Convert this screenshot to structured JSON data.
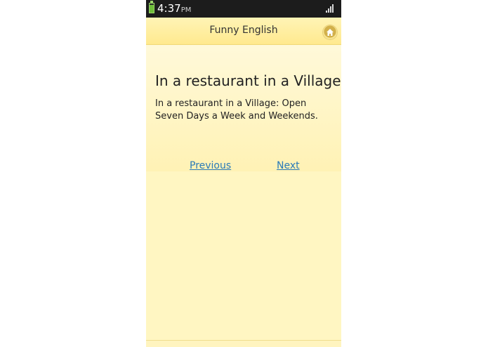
{
  "status_bar": {
    "time": "4:37",
    "ampm": "PM"
  },
  "header": {
    "title": "Funny English",
    "home_icon": "home-icon"
  },
  "article": {
    "title": "In a restaurant in a Village",
    "body": "In a restaurant in a Village: Open Seven Days a Week and Weekends."
  },
  "navigation": {
    "previous_label": "Previous",
    "next_label": "Next"
  },
  "colors": {
    "background": "#fff6c2",
    "header": "#ffe98e",
    "link": "#2a7ab8",
    "status_bar": "#1c1c1c"
  }
}
